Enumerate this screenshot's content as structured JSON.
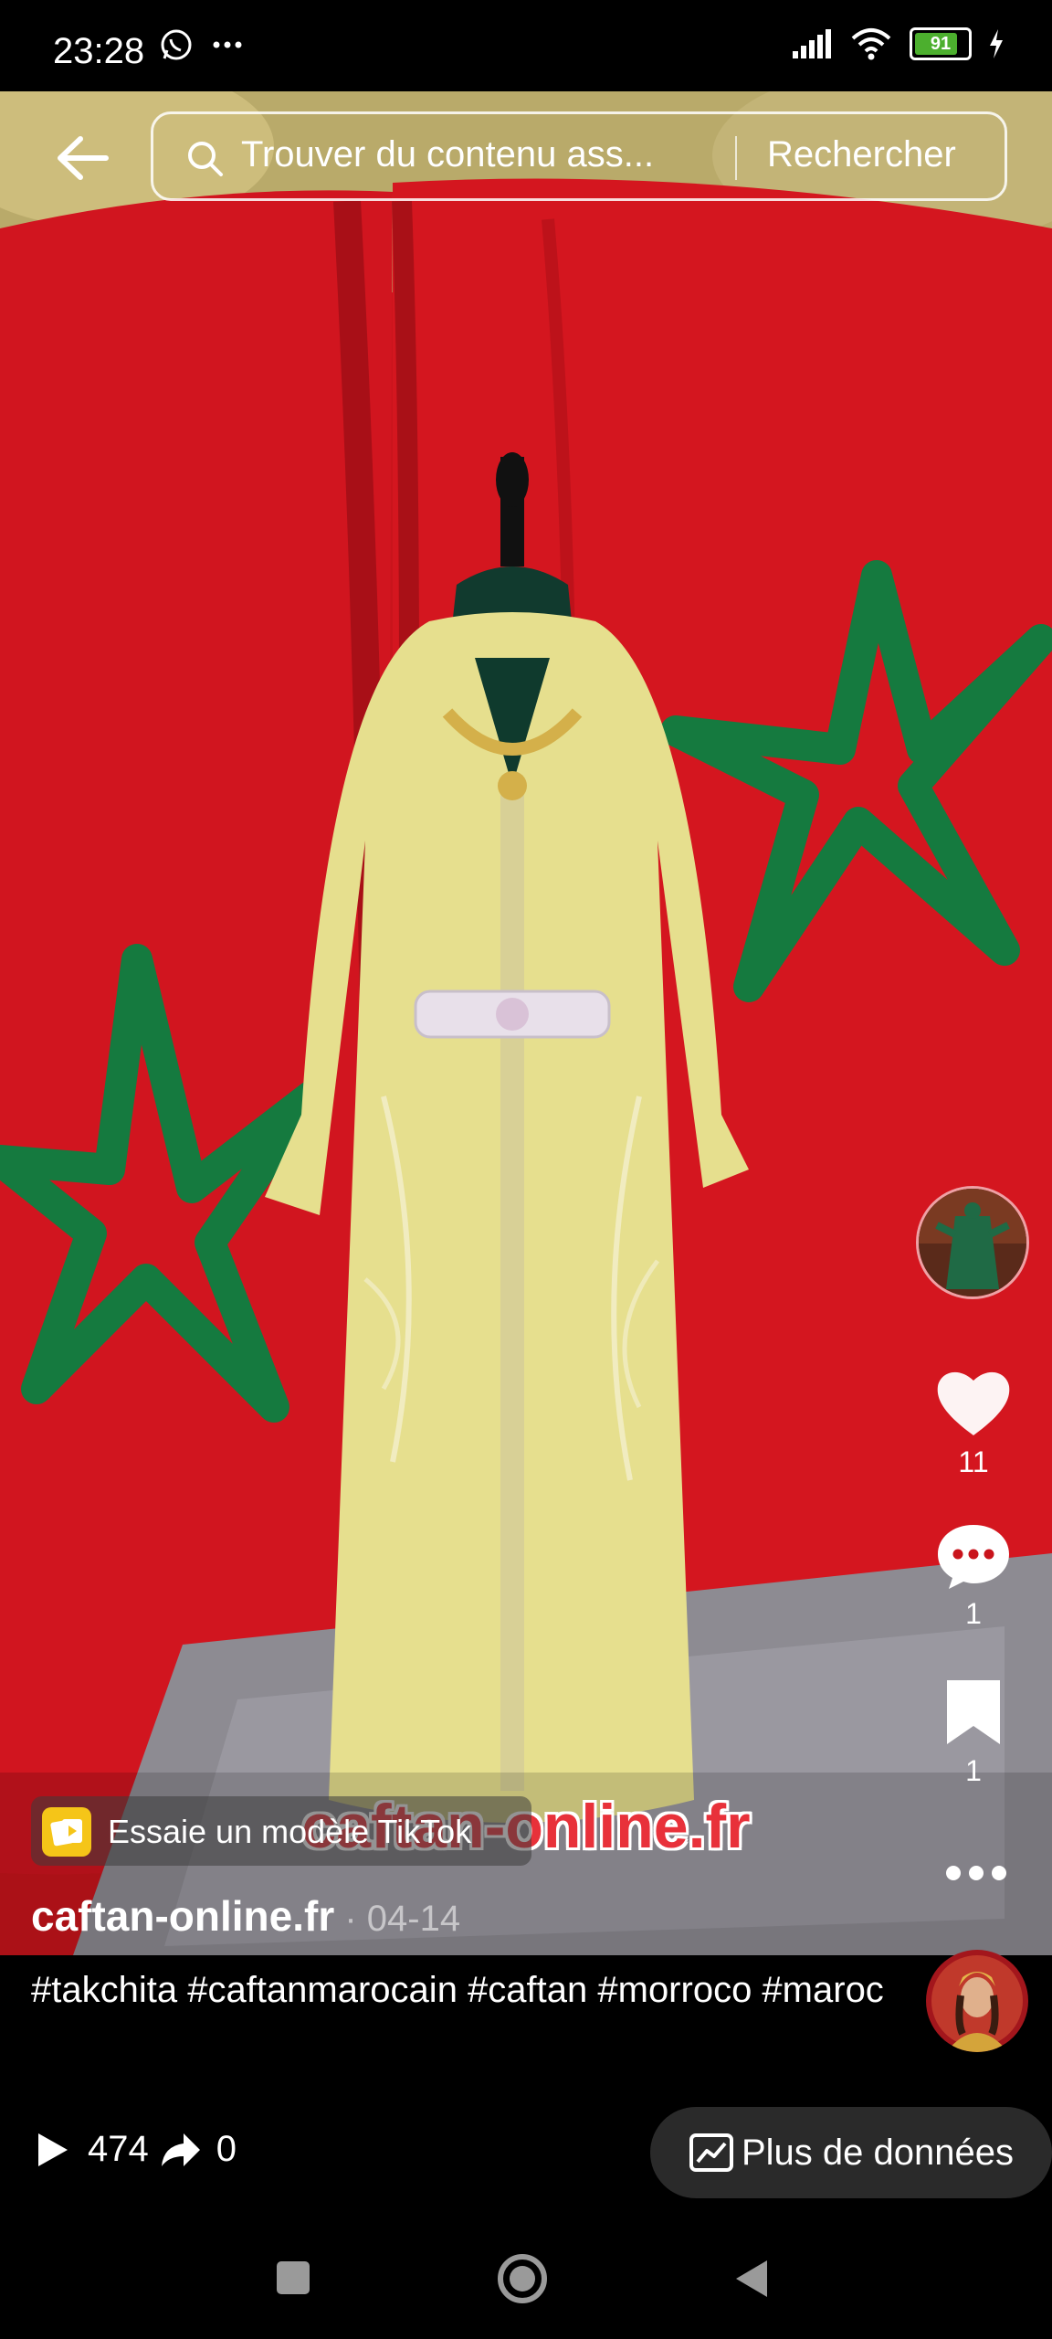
{
  "status_bar": {
    "time": "23:28",
    "battery": "91",
    "battery_level": 0.91,
    "icons_left": [
      "whatsapp-icon",
      "more-dots-icon"
    ],
    "icons_right": [
      "signal-icon",
      "wifi-icon",
      "battery-icon",
      "charging-icon"
    ]
  },
  "search": {
    "placeholder": "Trouver du contenu ass...",
    "button_label": "Rechercher"
  },
  "video": {
    "watermark": "caftan-online.fr"
  },
  "actions": {
    "likes": "11",
    "comments": "1",
    "saves": "1"
  },
  "template": {
    "label": "Essaie un modèle TikTok"
  },
  "post": {
    "author": "caftan-online.fr",
    "date": " · 04-14",
    "caption": "#takchita #caftanmarocain #caftan #morroco #maroc"
  },
  "stats": {
    "plays": "474",
    "shares": "0",
    "more_data_label": "Plus de données"
  },
  "colors": {
    "flag_red": "#c9141c",
    "flag_green": "#157a3f",
    "caftan_yellow": "#e6df8e",
    "like_white": "#ffffff",
    "battery_green": "#4caf2e"
  }
}
